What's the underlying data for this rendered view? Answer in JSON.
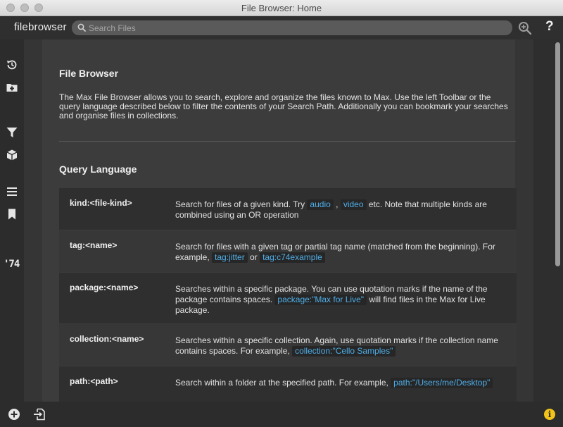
{
  "window": {
    "title": "File Browser: Home"
  },
  "toolbar": {
    "brand": "filebrowser",
    "search_placeholder": "Search Files",
    "help_label": "?"
  },
  "sidebar": {
    "logo_text": "'74",
    "items": [
      {
        "icon": "history-icon"
      },
      {
        "icon": "add-folder-icon"
      },
      {
        "icon": "filter-icon"
      },
      {
        "icon": "package-icon"
      },
      {
        "icon": "list-icon"
      },
      {
        "icon": "bookmark-icon"
      }
    ]
  },
  "content": {
    "title": "File Browser",
    "intro": "The Max File Browser allows you to search, explore and organize the files known to Max. Use the left Toolbar or the query language described below to filter the contents of your Search Path. Additionally you can bookmark your searches and organise files in collections.",
    "query_heading": "Query Language",
    "rows": [
      {
        "key": "kind:<file-kind>",
        "d1": "Search for files of a given kind. Try ",
        "c1": "audio",
        "d2": " , ",
        "c2": "video",
        "d3": " etc. Note that multiple kinds are combined using an OR operation"
      },
      {
        "key": "tag:<name>",
        "d1": "Search for files with a given tag or partial tag name (matched from the beginning). For example, ",
        "c1": "tag:jitter",
        "d2": " or ",
        "c2": "tag:c74example",
        "d3": ""
      },
      {
        "key": "package:<name>",
        "d1": "Searches within a specific package. You can use quotation marks if the name of the package contains spaces. ",
        "c1": "package:\"Max for Live\"",
        "d2": " will find files in the Max for Live package.",
        "c2": "",
        "d3": ""
      },
      {
        "key": "collection:<name>",
        "d1": "Searches within a specific collection. Again, use quotation marks if the collection name contains spaces. For example, ",
        "c1": "collection:\"Cello Samples\"",
        "d2": "",
        "c2": "",
        "d3": ""
      },
      {
        "key": "path:<path>",
        "d1": "Search within a folder at the specified path. For example, ",
        "c1": "path:\"/Users/me/Desktop\"",
        "d2": "",
        "c2": "",
        "d3": ""
      }
    ]
  },
  "bottombar": {
    "info_label": "i"
  },
  "colors": {
    "code_text": "#4faee8",
    "info_badge": "#f2c318",
    "background": "#3c3c3c"
  }
}
